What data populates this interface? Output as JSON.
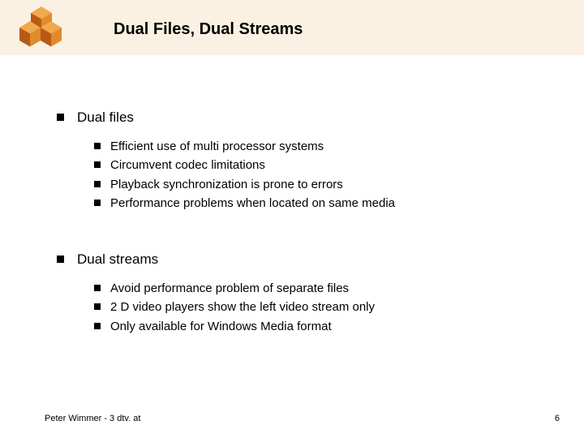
{
  "title": "Dual Files, Dual Streams",
  "sections": [
    {
      "heading": "Dual files",
      "items": [
        "Efficient use of multi processor systems",
        "Circumvent codec limitations",
        "Playback synchronization is prone to errors",
        "Performance problems when located on same media"
      ]
    },
    {
      "heading": "Dual streams",
      "items": [
        "Avoid performance problem of separate files",
        "2 D video players show the left video stream only",
        "Only available for Windows Media format"
      ]
    }
  ],
  "footer": {
    "left": "Peter Wimmer - 3 dtv. at",
    "right": "6"
  },
  "colors": {
    "header_bg": "#fbf1e2",
    "cube_dark": "#b85a16",
    "cube_light": "#e08a2e",
    "cube_lighter": "#f0a94c"
  }
}
